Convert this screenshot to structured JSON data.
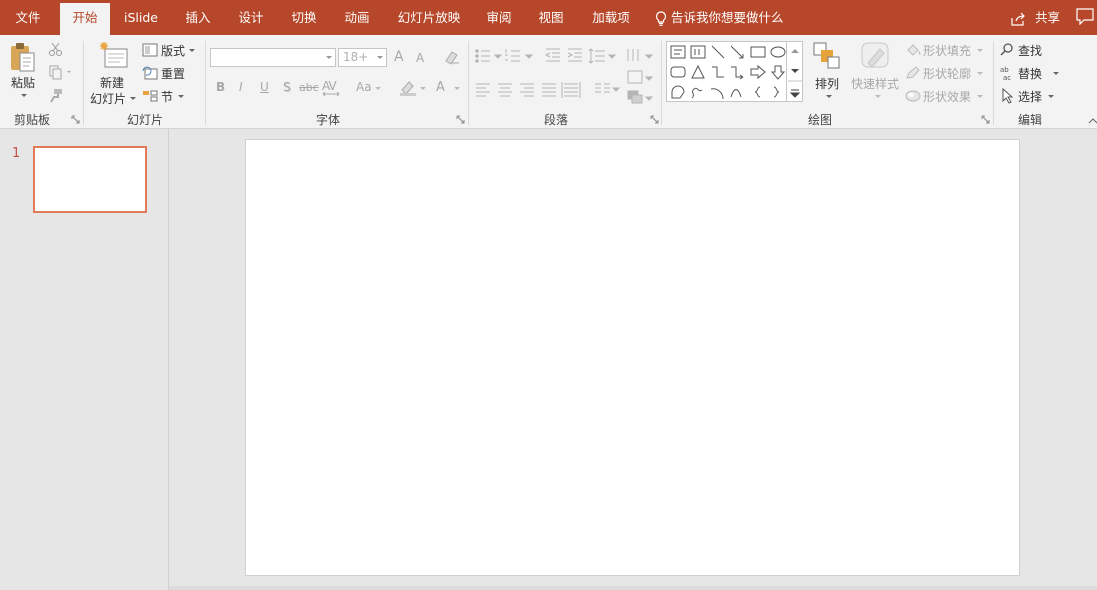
{
  "tabs": [
    {
      "key": "file",
      "label": "文件"
    },
    {
      "key": "home",
      "label": "开始"
    },
    {
      "key": "islide",
      "label": "iSlide"
    },
    {
      "key": "insert",
      "label": "插入"
    },
    {
      "key": "design",
      "label": "设计"
    },
    {
      "key": "transitions",
      "label": "切换"
    },
    {
      "key": "animations",
      "label": "动画"
    },
    {
      "key": "slideshow",
      "label": "幻灯片放映"
    },
    {
      "key": "review",
      "label": "审阅"
    },
    {
      "key": "view",
      "label": "视图"
    },
    {
      "key": "addins",
      "label": "加载项"
    }
  ],
  "active_tab": "开始",
  "tell_me": "告诉我你想要做什么",
  "share": "共享",
  "clipboard": {
    "paste": "粘贴",
    "group": "剪贴板"
  },
  "slides": {
    "new_line1": "新建",
    "new_line2": "幻灯片",
    "layout": "版式",
    "reset": "重置",
    "section": "节",
    "group": "幻灯片"
  },
  "font": {
    "font_size": "18+",
    "group": "字体",
    "bold": "B",
    "italic": "I",
    "underline": "U",
    "shadow": "S",
    "strike": "abc",
    "spacing": "AV",
    "case": "Aa",
    "grow": "A",
    "shrink": "A",
    "color": "A"
  },
  "paragraph": {
    "group": "段落"
  },
  "drawing": {
    "arrange": "排列",
    "quick_styles": "快速样式",
    "shape_fill": "形状填充",
    "shape_outline": "形状轮廓",
    "shape_effects": "形状效果",
    "group": "绘图"
  },
  "editing": {
    "find": "查找",
    "replace": "替换",
    "select": "选择",
    "group": "编辑"
  },
  "thumbnail": {
    "slide_number": "1"
  },
  "colors": {
    "accent": "#b7472a",
    "thumb_border": "#e07a58"
  }
}
